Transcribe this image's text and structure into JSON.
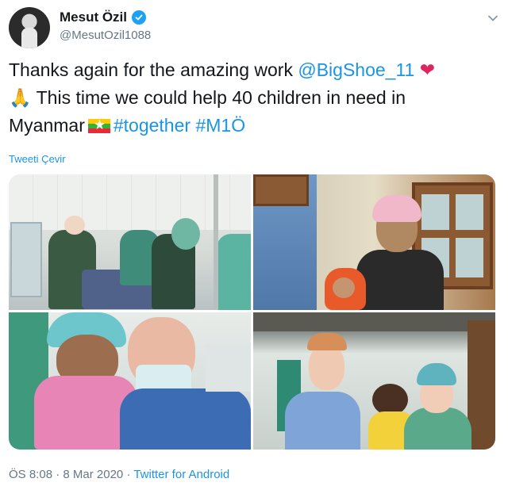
{
  "author": {
    "display_name": "Mesut Özil",
    "handle": "@MesutOzil1088",
    "avatar_icon": "profile-photo",
    "verified_icon": "verified-badge-icon"
  },
  "tweet": {
    "line1_text": "Thanks again for the amazing work ",
    "line1_mention": "@BigShoe_11",
    "line1_emoji": "❤",
    "line2_emoji": "🙏",
    "line2_text": " This time we could help 40 children in need in",
    "line3_text": "Myanmar",
    "line3_flag_icon": "myanmar-flag-icon",
    "hashtag1": "#together",
    "hashtag2": "#M1Ö"
  },
  "translate_label": "Tweeti Çevir",
  "media": [
    {
      "name": "surgery-photo"
    },
    {
      "name": "mother-child-photo"
    },
    {
      "name": "doctor-holding-child-photo"
    },
    {
      "name": "medical-team-with-child-photo"
    }
  ],
  "footer": {
    "time": "ÖS 8:08",
    "separator1": " · ",
    "date": "8 Mar 2020",
    "separator2": " · ",
    "app": "Twitter for Android"
  },
  "colors": {
    "link": "#1b95e0",
    "verified": "#1da1f2",
    "heart": "#e0245e",
    "secondary_text": "#657786"
  }
}
